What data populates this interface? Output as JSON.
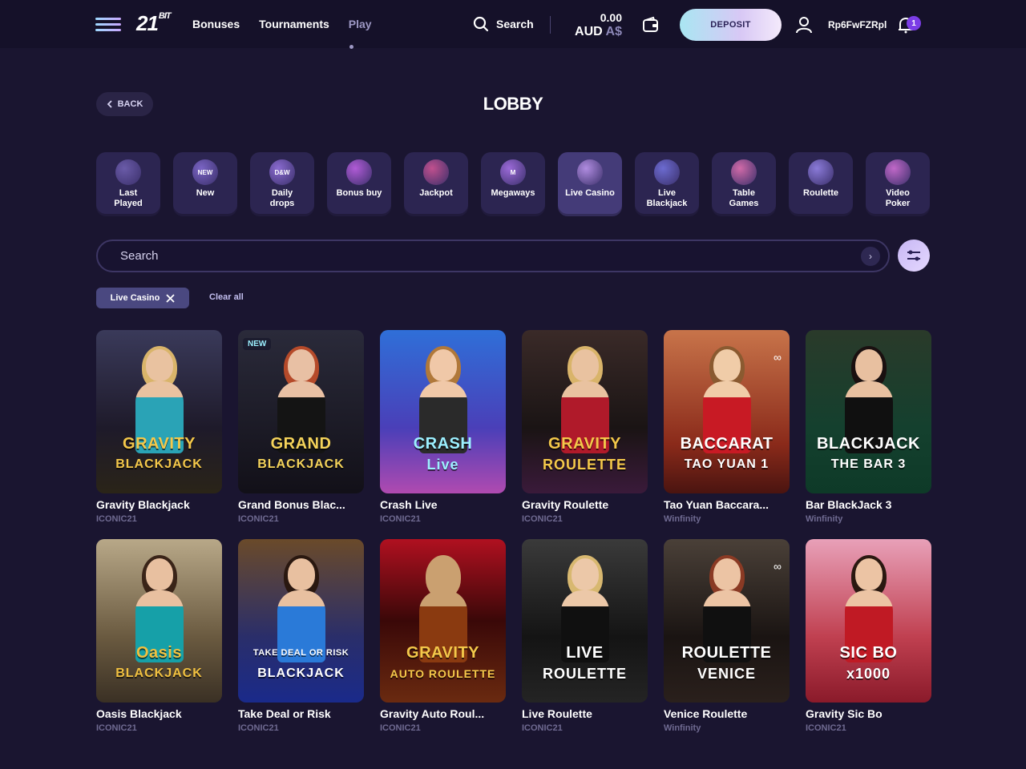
{
  "header": {
    "logo": "21",
    "logo_small": "BIT",
    "nav": [
      {
        "label": "Bonuses"
      },
      {
        "label": "Tournaments"
      },
      {
        "label": "Play"
      }
    ],
    "search_label": "Search",
    "balance_amount": "0.00",
    "balance_currency": "AUD",
    "balance_symbol": "A$",
    "deposit_label": "DEPOSIT",
    "username": "Rp6FwFZRpl",
    "notifications_count": "1"
  },
  "page": {
    "back_label": "BACK",
    "title": "LOBBY"
  },
  "categories": [
    {
      "label1": "Last",
      "label2": "Played",
      "color": "#6a5ba8",
      "icon": "play-icon"
    },
    {
      "label1": "New",
      "label2": "",
      "color": "#7a64c4",
      "icon": "new-icon",
      "mark": "NEW"
    },
    {
      "label1": "Daily",
      "label2": "drops",
      "color": "#8a6bd0",
      "icon": "drops-icon",
      "mark": "D&W"
    },
    {
      "label1": "Bonus buy",
      "label2": "",
      "color": "#b05bd6",
      "icon": "gift-icon"
    },
    {
      "label1": "Jackpot",
      "label2": "",
      "color": "#c0508e",
      "icon": "jackpot-icon"
    },
    {
      "label1": "Megaways",
      "label2": "",
      "color": "#9b6ad8",
      "icon": "megaways-icon",
      "mark": "M"
    },
    {
      "label1": "Live Casino",
      "label2": "",
      "color": "#b08ce0",
      "icon": "spade-icon",
      "active": true
    },
    {
      "label1": "Live",
      "label2": "Blackjack",
      "color": "#6c6bd0",
      "icon": "card-icon"
    },
    {
      "label1": "Table",
      "label2": "Games",
      "color": "#d06aa8",
      "icon": "table-icon"
    },
    {
      "label1": "Roulette",
      "label2": "",
      "color": "#8a7ad8",
      "icon": "roulette-icon"
    },
    {
      "label1": "Video",
      "label2": "Poker",
      "color": "#c068c8",
      "icon": "poker-icon"
    }
  ],
  "search": {
    "placeholder": "Search"
  },
  "filters": {
    "active_chip": "Live Casino",
    "clear_label": "Clear all"
  },
  "games": [
    {
      "name": "Gravity Blackjack",
      "provider": "ICONIC21",
      "logo": "GRAVITY",
      "logo2": "BLACKJACK",
      "bg": "linear-gradient(180deg,#3a3a5a,#1e1a2a 60%,#2a2418)",
      "skin": "#e9c2a0",
      "hair": "#d9b46a",
      "dress": "#2aa3b6",
      "logoColor": "#f4c84a"
    },
    {
      "name": "Grand Bonus Blac...",
      "provider": "ICONIC21",
      "logo": "GRAND",
      "logo2": "BLACKJACK",
      "bg": "linear-gradient(180deg,#2a2a3a,#121018)",
      "skin": "#e8c0a4",
      "hair": "#b54a2a",
      "dress": "#141414",
      "logoColor": "#f4d35a",
      "badge": "NEW"
    },
    {
      "name": "Crash Live",
      "provider": "ICONIC21",
      "logo": "CRASH",
      "logo2": "Live",
      "bg": "linear-gradient(180deg,#2f6fd8,#4a3fb8 60%,#b04ab0)",
      "skin": "#f0c8a8",
      "hair": "#b0783a",
      "dress": "#2a2a2a",
      "logoColor": "#9cf0ff"
    },
    {
      "name": "Gravity Roulette",
      "provider": "ICONIC21",
      "logo": "GRAVITY",
      "logo2": "ROULETTE",
      "bg": "linear-gradient(180deg,#3a2a28,#1a1414 60%,#3a1a3a)",
      "skin": "#e9c2a0",
      "hair": "#d9b46a",
      "dress": "#b01a2a",
      "logoColor": "#f4c84a"
    },
    {
      "name": "Tao Yuan Baccara...",
      "provider": "Winfinity",
      "logo": "BACCARAT",
      "logo2": "TAO YUAN 1",
      "bg": "linear-gradient(180deg,#c8744a,#8a2a1a 70%,#4a1410)",
      "skin": "#f0cca8",
      "hair": "#8a5a30",
      "dress": "#c81a24",
      "logoColor": "#ffffff",
      "inf": true
    },
    {
      "name": "Bar BlackJack 3",
      "provider": "Winfinity",
      "logo": "BLACKJACK",
      "logo2": "THE BAR 3",
      "bg": "linear-gradient(180deg,#2a3a2a,#14402e 60%,#0e3a28)",
      "skin": "#e8c0a0",
      "hair": "#1a1010",
      "dress": "#101010",
      "logoColor": "#ffffff"
    },
    {
      "name": "Oasis Blackjack",
      "provider": "ICONIC21",
      "logo": "Oasis",
      "logo2": "BLACKJACK",
      "bg": "linear-gradient(180deg,#b8a888,#6a5a40 60%,#3a3024)",
      "skin": "#e8c0a0",
      "hair": "#3a2418",
      "dress": "#16a0a8",
      "logoColor": "#f0c040"
    },
    {
      "name": "Take Deal or Risk",
      "provider": "ICONIC21",
      "logo": "TAKE DEAL OR RISK",
      "logo2": "BLACKJACK",
      "bg": "linear-gradient(180deg,#6a4a2a,#2a2e6a 60%,#1a2a8a)",
      "skin": "#e8c0a0",
      "hair": "#2a1810",
      "dress": "#2a7ad8",
      "logoColor": "#ffffff"
    },
    {
      "name": "Gravity Auto Roul...",
      "provider": "ICONIC21",
      "logo": "GRAVITY",
      "logo2": "AUTO ROULETTE",
      "bg": "linear-gradient(180deg,#b01020,#3a0808 50%,#6a2a10)",
      "skin": "#caa070",
      "hair": "#caa070",
      "dress": "#8a3a10",
      "logoColor": "#f4c84a"
    },
    {
      "name": "Live Roulette",
      "provider": "ICONIC21",
      "logo": "LIVE",
      "logo2": "ROULETTE",
      "bg": "linear-gradient(180deg,#3a3a3a,#141414 60%,#242424)",
      "skin": "#ecc8a8",
      "hair": "#d8b870",
      "dress": "#101010",
      "logoColor": "#ffffff"
    },
    {
      "name": "Venice Roulette",
      "provider": "Winfinity",
      "logo": "ROULETTE",
      "logo2": "VENICE",
      "bg": "linear-gradient(180deg,#4a4038,#1a1412 60%,#2a201c)",
      "skin": "#ecc4a4",
      "hair": "#8a3a24",
      "dress": "#101010",
      "logoColor": "#ffffff",
      "inf": true
    },
    {
      "name": "Gravity Sic Bo",
      "provider": "ICONIC21",
      "logo": "SIC BO",
      "logo2": "x1000",
      "bg": "linear-gradient(180deg,#e8a0b8,#c04050 60%,#8a1a2a)",
      "skin": "#ecc4a4",
      "hair": "#2a1810",
      "dress": "#c01a24",
      "logoColor": "#ffffff"
    }
  ],
  "colors": {
    "background": "#1a1530",
    "header": "#151129",
    "accent": "#7b3de6",
    "muted_text": "#6f6a91"
  }
}
